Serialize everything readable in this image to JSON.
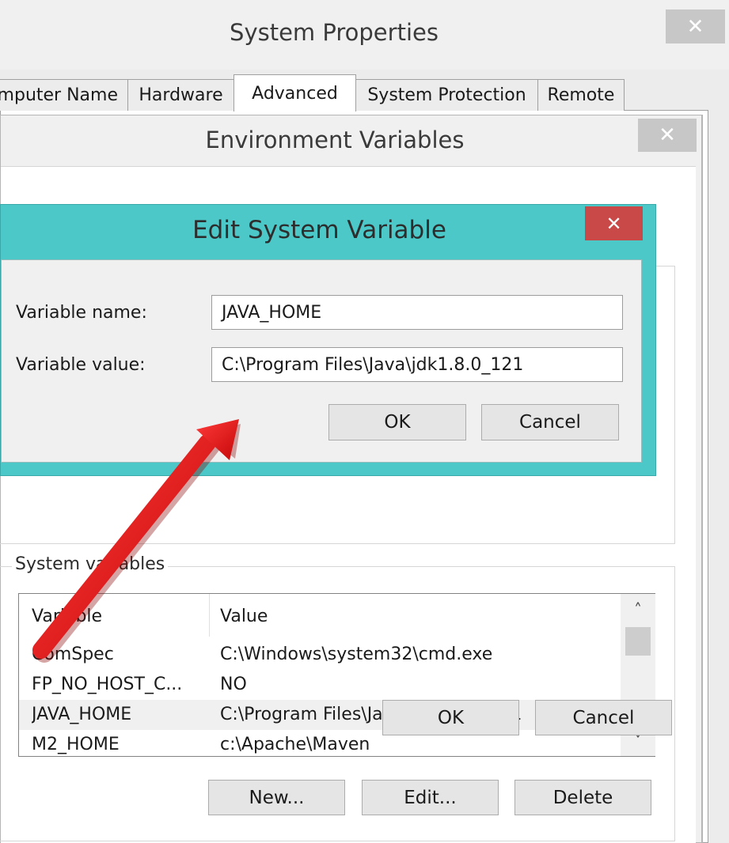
{
  "system_properties": {
    "title": "System Properties",
    "close_glyph": "✕",
    "tabs": [
      {
        "label": "Computer Name",
        "active": false
      },
      {
        "label": "Hardware",
        "active": false
      },
      {
        "label": "Advanced",
        "active": true
      },
      {
        "label": "System Protection",
        "active": false
      },
      {
        "label": "Remote",
        "active": false
      }
    ]
  },
  "environment_variables": {
    "title": "Environment Variables",
    "close_glyph": "✕",
    "system_variables": {
      "group_label": "System variables",
      "columns": {
        "name": "Variable",
        "value": "Value"
      },
      "rows": [
        {
          "name": "ComSpec",
          "value": "C:\\Windows\\system32\\cmd.exe",
          "selected": false
        },
        {
          "name": "FP_NO_HOST_C...",
          "value": "NO",
          "selected": false
        },
        {
          "name": "JAVA_HOME",
          "value": "C:\\Program Files\\Java\\jdk1.8.0_121",
          "selected": true
        },
        {
          "name": "M2_HOME",
          "value": "c:\\Apache\\Maven",
          "selected": false
        }
      ],
      "scroll_up_glyph": "˄",
      "scroll_down_glyph": "˅",
      "buttons": {
        "new": "New...",
        "edit": "Edit...",
        "delete": "Delete"
      }
    },
    "buttons": {
      "ok": "OK",
      "cancel": "Cancel"
    }
  },
  "edit_system_variable": {
    "title": "Edit System Variable",
    "close_glyph": "✕",
    "name_label": "Variable name:",
    "name_value": "JAVA_HOME",
    "value_label": "Variable value:",
    "value_value": "C:\\Program Files\\Java\\jdk1.8.0_121",
    "buttons": {
      "ok": "OK",
      "cancel": "Cancel"
    }
  },
  "colors": {
    "dialog_frame": "#4cc8c8",
    "close_active": "#c94848",
    "annotation_arrow": "#e01010"
  }
}
